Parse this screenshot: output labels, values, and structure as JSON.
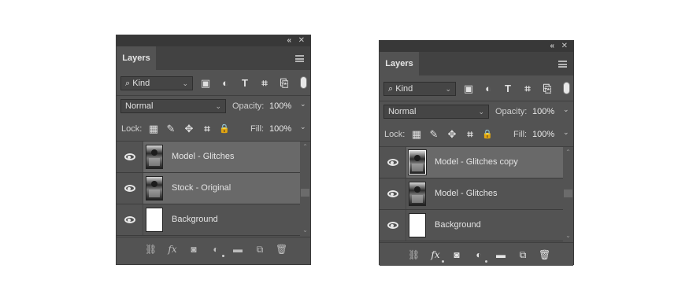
{
  "panels": [
    {
      "id": "left",
      "tab": "Layers",
      "filter": "Kind",
      "blend": "Normal",
      "opacity_label": "Opacity:",
      "opacity": "100%",
      "lock_label": "Lock:",
      "fill_label": "Fill:",
      "fill": "100%",
      "layers": [
        {
          "name": "Model - Glitches",
          "selected": true,
          "thumb": "photo"
        },
        {
          "name": "Stock - Original",
          "selected": true,
          "thumb": "photo"
        },
        {
          "name": "Background",
          "selected": false,
          "thumb": "white"
        }
      ]
    },
    {
      "id": "right",
      "tab": "Layers",
      "filter": "Kind",
      "blend": "Normal",
      "opacity_label": "Opacity:",
      "opacity": "100%",
      "lock_label": "Lock:",
      "fill_label": "Fill:",
      "fill": "100%",
      "layers": [
        {
          "name": "Model - Glitches copy",
          "selected": true,
          "thumb": "photo"
        },
        {
          "name": "Model - Glitches",
          "selected": false,
          "thumb": "photo"
        },
        {
          "name": "Background",
          "selected": false,
          "thumb": "white"
        }
      ]
    }
  ],
  "icons": {
    "collapse": "«",
    "close": "✕",
    "search": "⌕",
    "image": "▣",
    "adjustment": "◐",
    "type": "T",
    "shape": "⌗",
    "smart": "⎘",
    "lock_pixels": "▦",
    "lock_brush": "✎",
    "lock_move": "✥",
    "lock_artboard": "⌗",
    "lock_all": "🔒",
    "link": "⛓",
    "fx": "fx",
    "mask": "◙",
    "fill_adj": "◐",
    "group": "▬",
    "new_layer": "⧉",
    "trash": "🗑",
    "caret": "⌄",
    "up": "⌃",
    "down": "⌄"
  }
}
